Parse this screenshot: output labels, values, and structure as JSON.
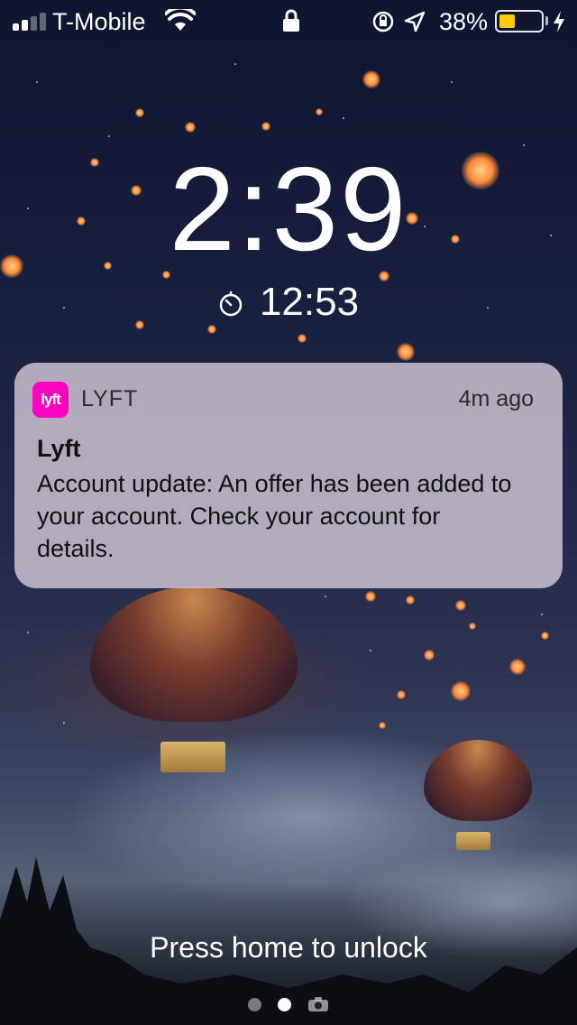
{
  "status_bar": {
    "carrier": "T-Mobile",
    "signal_bars_filled": 2,
    "signal_bars_total": 4,
    "battery_percent_label": "38%",
    "battery_level": 0.38,
    "battery_color": "#ffcc00",
    "icons": [
      "signal-icon",
      "wifi-icon",
      "lock-icon",
      "rotation-lock-icon",
      "location-icon",
      "battery-icon",
      "charging-bolt-icon"
    ]
  },
  "lock_screen": {
    "time": "2:39",
    "timer": "12:53",
    "timer_icon": "timer-icon"
  },
  "notification": {
    "app_name": "LYFT",
    "app_icon_text": "lyft",
    "app_icon_color": "#ff00bf",
    "time_ago": "4m ago",
    "title": "Lyft",
    "body": "Account update: An offer has been added to your account. Check your account for details."
  },
  "bottom": {
    "unlock_hint": "Press home to unlock",
    "pages": [
      "page-dot",
      "page-dot-active",
      "camera-icon"
    ]
  }
}
